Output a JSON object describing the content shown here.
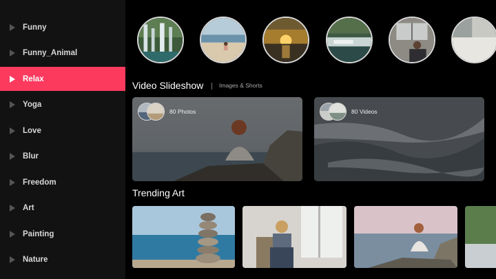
{
  "sidebar": {
    "items": [
      {
        "label": "Funny",
        "active": false
      },
      {
        "label": "Funny_Animal",
        "active": false
      },
      {
        "label": "Relax",
        "active": true
      },
      {
        "label": "Yoga",
        "active": false
      },
      {
        "label": "Love",
        "active": false
      },
      {
        "label": "Blur",
        "active": false
      },
      {
        "label": "Freedom",
        "active": false
      },
      {
        "label": "Art",
        "active": false
      },
      {
        "label": "Painting",
        "active": false
      },
      {
        "label": "Nature",
        "active": false
      }
    ]
  },
  "stories": [
    {
      "icon": "waterfall-forest-thumbnail"
    },
    {
      "icon": "woman-on-beach-thumbnail"
    },
    {
      "icon": "sunset-sea-thumbnail"
    },
    {
      "icon": "river-rapids-thumbnail"
    },
    {
      "icon": "woman-indoors-thumbnail"
    },
    {
      "icon": "sea-foam-thumbnail"
    }
  ],
  "video_slideshow": {
    "title": "Video Slideshow",
    "subtitle": "Images & Shorts",
    "cards": [
      {
        "count_label": "80 Photos"
      },
      {
        "count_label": "80 Videos"
      }
    ]
  },
  "trending": {
    "title": "Trending Art",
    "tiles": [
      {
        "icon": "stacked-stones-art"
      },
      {
        "icon": "woman-window-art"
      },
      {
        "icon": "woman-rock-sunset-art"
      },
      {
        "icon": "coast-art"
      }
    ]
  },
  "colors": {
    "accent": "#fb3a5e",
    "sidebar_bg": "#121212",
    "background": "#000000"
  }
}
